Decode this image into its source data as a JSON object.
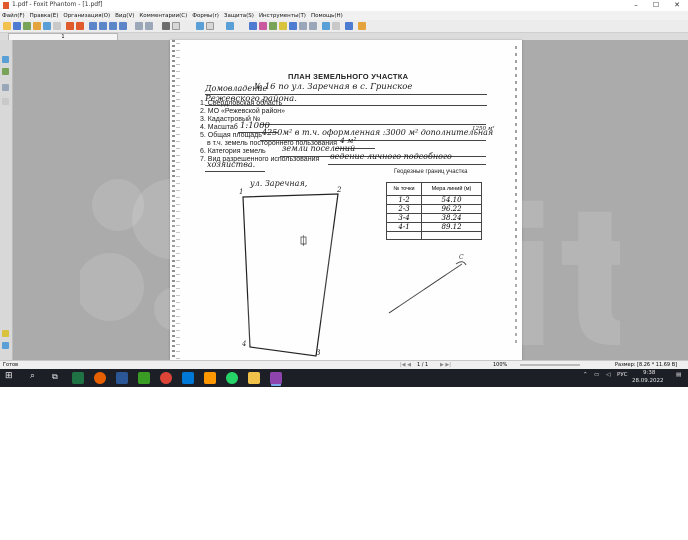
{
  "window": {
    "title": "1.pdf - Foxit Phantom - [1.pdf]",
    "minimize": "–",
    "maximize": "☐",
    "close": "✕"
  },
  "menu": [
    "Файл(F)",
    "Правка(E)",
    "Организация(O)",
    "Вид(V)",
    "Комментарии(C)",
    "Формы(r)",
    "Защита(S)",
    "Инструменты(T)",
    "Помощь(H)"
  ],
  "tab": {
    "label": "1"
  },
  "document": {
    "heading": "ПЛАН ЗЕМЕЛЬНОГО УЧАСТКА",
    "owner_prefix": "Домовладение",
    "owner_hand": "№ 16   по  ул. Заречная     в  с. Гринское",
    "owner_hand2": "Режевского      района.",
    "item1": "1. Свердловская область",
    "item2": "2. МО «Режевской район»",
    "item3": "3. Кадастровый №",
    "item4_label": "4. Масштаб",
    "item4_value": "1:1000",
    "item5_label": "5. Общая площадь",
    "item5_value": "4250м² в т.ч. оформленная :3000 м² дополнительная",
    "item5_extra": "1250 м²",
    "item5b_label": "в т.ч. земель постороннего пользования",
    "item5b_value": "4 м²",
    "item6_label": "6. Категория земель",
    "item6_value": "земли поселений",
    "item7_label": "7. Вид разрешенного использования",
    "item7_value": "ведение    личного    подсобного",
    "item7_value2": "хозяйства.",
    "street_label": "ул. Заречная,",
    "corner_1": "1",
    "corner_2": "2",
    "corner_3": "3",
    "corner_4": "4",
    "north_label": "С",
    "table_title": "Геодезные границ участка",
    "table_headers": [
      "№ точки",
      "Мера линий (м)"
    ],
    "table_rows": [
      [
        "1-2",
        "54.10"
      ],
      [
        "2-3",
        "96.22"
      ],
      [
        "3-4",
        "38.24"
      ],
      [
        "4-1",
        "89.12"
      ]
    ]
  },
  "status": {
    "ready": "Готов",
    "page_info": "1 / 1",
    "zoom": "100%",
    "page_size": "Размер: [8.26 * 11.69 В]"
  },
  "taskbar": {
    "lang": "РУС",
    "time": "9:38",
    "date": "28.09.2022"
  },
  "watermark": {
    "text": "Avito"
  },
  "colors": {
    "taskbar": "#1d1f27",
    "accent": "#e05a2b"
  }
}
